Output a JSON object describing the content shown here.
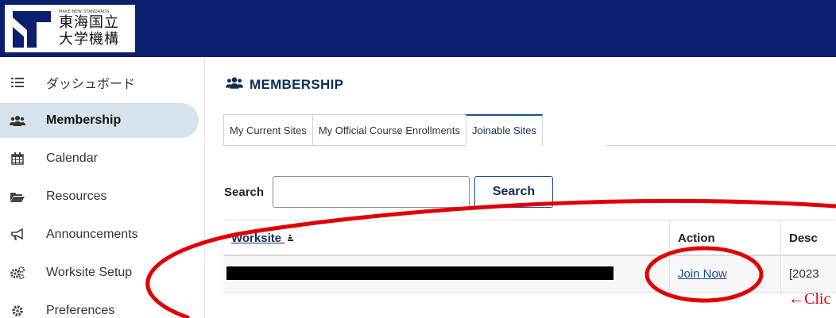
{
  "header": {
    "logo_tagline": "MAKE NEW STANDARDS.",
    "logo_line1": "東海国立",
    "logo_line2": "大学機構"
  },
  "sidebar": {
    "items": [
      {
        "label": "ダッシュボード",
        "icon": "list-icon",
        "active": false
      },
      {
        "label": "Membership",
        "icon": "users-icon",
        "active": true
      },
      {
        "label": "Calendar",
        "icon": "calendar-icon",
        "active": false
      },
      {
        "label": "Resources",
        "icon": "folder-open-icon",
        "active": false
      },
      {
        "label": "Announcements",
        "icon": "bullhorn-icon",
        "active": false
      },
      {
        "label": "Worksite Setup",
        "icon": "cogs-icon",
        "active": false
      },
      {
        "label": "Preferences",
        "icon": "gear-icon",
        "active": false
      }
    ]
  },
  "main": {
    "title": "MEMBERSHIP",
    "tabs": [
      {
        "label": "My Current Sites",
        "active": false
      },
      {
        "label": "My Official Course Enrollments",
        "active": false
      },
      {
        "label": "Joinable Sites",
        "active": true
      }
    ],
    "search": {
      "label": "Search",
      "value": "",
      "button_label": "Search"
    },
    "table": {
      "columns": [
        "Worksite",
        "Action",
        "Desc"
      ],
      "rows": [
        {
          "worksite": "",
          "action": "Join Now",
          "description": "[2023"
        }
      ]
    }
  },
  "annotation": {
    "note": "←Clic"
  },
  "colors": {
    "header_bg": "#0b1f6e",
    "active_nav_bg": "#d6e3ec",
    "link": "#1a4f8f",
    "annotation_red": "#e00000"
  }
}
